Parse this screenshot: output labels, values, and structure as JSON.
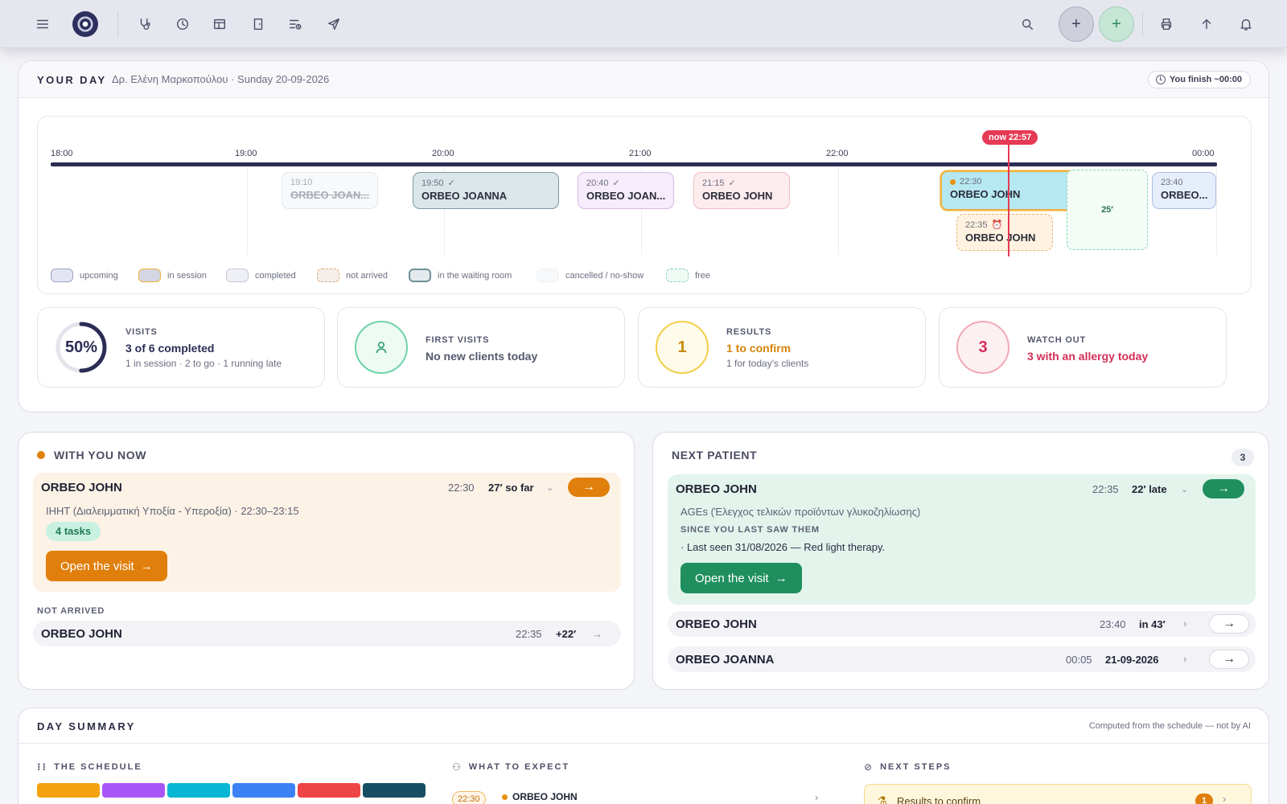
{
  "topbar": {
    "icons": [
      "menu-icon",
      "logo",
      "stethoscope-icon",
      "clock-icon",
      "layout-icon",
      "door-icon",
      "list-clock-icon",
      "send-icon",
      "search-icon",
      "plus-icon",
      "plus-icon",
      "print-icon",
      "upload-icon",
      "bell-icon"
    ],
    "plus_gray": "+",
    "plus_green": "+"
  },
  "your_day": {
    "title": "YOUR DAY",
    "subtitle": "Δρ. Ελένη Μαρκοπούλου · Sunday 20-09-2026",
    "finish": "You finish ~00:00",
    "hours": [
      "18:00",
      "19:00",
      "20:00",
      "21:00",
      "22:00",
      "00:00"
    ],
    "now": "now 22:57",
    "appointments": [
      {
        "time": "19:10",
        "name": "ORBEO JOAN...",
        "status": "cancelled",
        "check": false
      },
      {
        "time": "19:50",
        "name": "ORBEO JOANNA",
        "status": "waiting",
        "check": true
      },
      {
        "time": "20:40",
        "name": "ORBEO JOAN...",
        "status": "completed",
        "check": true
      },
      {
        "time": "21:15",
        "name": "ORBEO JOHN",
        "status": "completed",
        "check": true
      },
      {
        "time": "22:30",
        "name": "ORBEO JOHN",
        "status": "in-session",
        "check": false
      },
      {
        "time": "22:35",
        "name": "ORBEO JOHN",
        "status": "not-arrived",
        "check": false
      },
      {
        "time": "23:40",
        "name": "ORBEO...",
        "status": "upcoming",
        "check": false
      }
    ],
    "free_slot": "25′",
    "legend": [
      "upcoming",
      "in session",
      "completed",
      "not arrived",
      "in the waiting room",
      "cancelled / no-show",
      "free"
    ]
  },
  "stats": {
    "visits": {
      "circle": "50%",
      "label": "VISITS",
      "value": "3 of 6 completed",
      "sub": "1 in session · 2 to go · 1 running late",
      "progress": 0.5
    },
    "first_visits": {
      "label": "FIRST VISITS",
      "value": "No new clients today"
    },
    "results": {
      "circle": "1",
      "label": "RESULTS",
      "value": "1 to confirm",
      "sub": "1 for today's clients"
    },
    "watch_out": {
      "circle": "3",
      "label": "WATCH OUT",
      "value": "3 with an allergy today"
    }
  },
  "with_you_now": {
    "title": "WITH YOU NOW",
    "patient": "ORBEO JOHN",
    "time": "22:30",
    "elapsed": "27′ so far",
    "detail": "ΙΗΗΤ (Διαλειμματική Υποξία - Υπεροξία) · 22:30–23:15",
    "tasks": "4 tasks",
    "open_btn": "Open the visit",
    "not_arrived_label": "NOT ARRIVED",
    "not_arrived": {
      "name": "ORBEO JOHN",
      "time": "22:35",
      "delay": "+22′"
    }
  },
  "next_patient": {
    "title": "NEXT PATIENT",
    "count": "3",
    "patient": "ORBEO JOHN",
    "time": "22:35",
    "late": "22′ late",
    "detail": "AGEs (Έλεγχος τελικών προϊόντων γλυκοζηλίωσης)",
    "since_label": "SINCE YOU LAST SAW THEM",
    "since_text": "· Last seen 31/08/2026 — Red light therapy.",
    "open_btn": "Open the visit",
    "others": [
      {
        "name": "ORBEO JOHN",
        "time": "23:40",
        "when": "in 43′"
      },
      {
        "name": "ORBEO JOANNA",
        "time": "00:05",
        "when": "21-09-2026"
      }
    ]
  },
  "summary": {
    "title": "DAY SUMMARY",
    "note": "Computed from the schedule — not by AI",
    "schedule_label": "THE SCHEDULE",
    "expect_label": "WHAT TO EXPECT",
    "steps_label": "NEXT STEPS",
    "expect_time": "22:30",
    "expect_name": "ORBEO JOHN",
    "steps_item": "Results to confirm",
    "steps_count": "1",
    "schedule_colors": [
      "#f5a20f",
      "#a855f7",
      "#06b6d4",
      "#3b82f6",
      "#ef4444",
      "#164e63"
    ]
  },
  "colors": {
    "accent_orange": "#e07f0b",
    "accent_green": "#1f8f5f",
    "alert_red": "#e53a55",
    "navy": "#2c2d55"
  }
}
